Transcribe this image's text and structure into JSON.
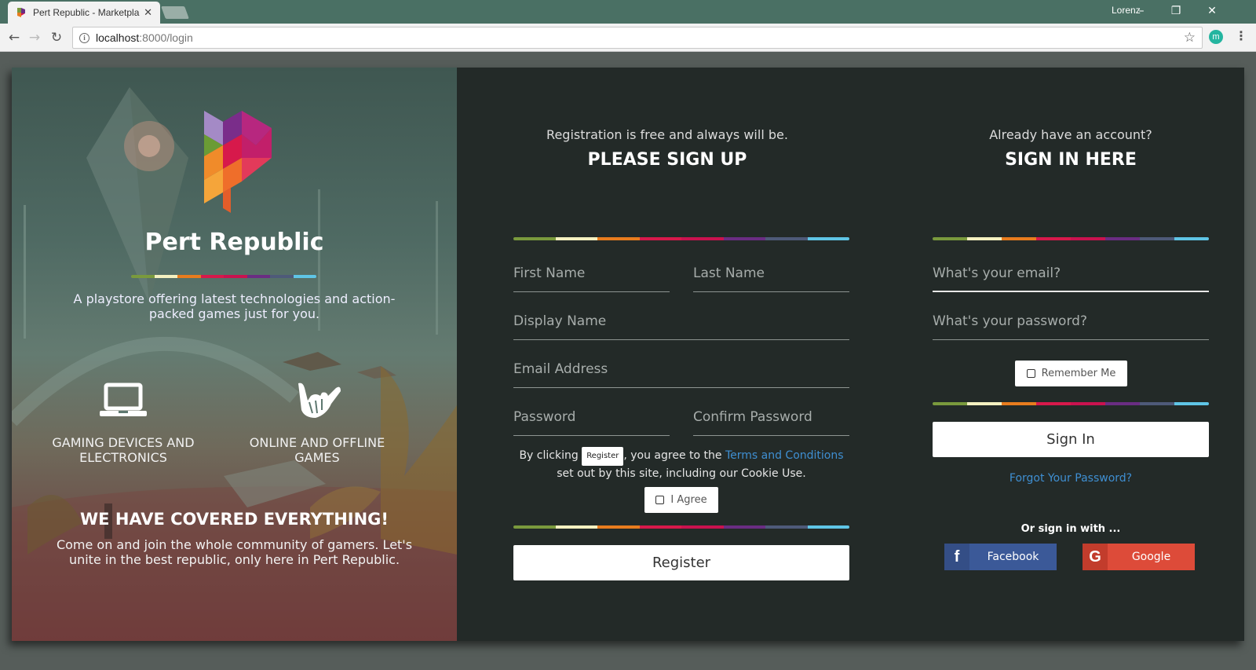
{
  "browser": {
    "tab_title": "Pert Republic - Marketpla",
    "url_host": "localhost",
    "url_rest": ":8000/login",
    "profile_name": "Lorenz",
    "extension_letter": "m"
  },
  "stripe_colors": [
    "#7a9a3d",
    "#f4f0c0",
    "#e87c1e",
    "#d7194b",
    "#c9124f",
    "#6a2d83",
    "#4e5a79",
    "#5fc5e6"
  ],
  "brand": {
    "name": "Pert Republic",
    "tagline": "A playstore offering latest technologies and action-packed games just for you."
  },
  "features": [
    {
      "label": "GAMING DEVICES AND ELECTRONICS",
      "icon": "laptop-icon"
    },
    {
      "label": "ONLINE AND OFFLINE GAMES",
      "icon": "shaka-hand-icon"
    }
  ],
  "cover": {
    "title": "WE HAVE COVERED EVERYTHING!",
    "text": "Come on and join the whole community of gamers. Let's unite in the best republic, only here in Pert Republic."
  },
  "signup": {
    "subtitle": "Registration is free and always will be.",
    "title": "PLEASE SIGN UP",
    "first_name_placeholder": "First Name",
    "last_name_placeholder": "Last Name",
    "display_name_placeholder": "Display Name",
    "email_placeholder": "Email Address",
    "password_placeholder": "Password",
    "confirm_password_placeholder": "Confirm Password",
    "agree_prefix": "By clicking",
    "agree_inline_button": "Register",
    "agree_middle": ", you agree to the",
    "terms_link": "Terms and Conditions",
    "agree_suffix": "set out by this site, including our Cookie Use.",
    "agree_checkbox": "I Agree",
    "register_button": "Register"
  },
  "signin": {
    "subtitle": "Already have an account?",
    "title": "SIGN IN HERE",
    "email_placeholder": "What's your email?",
    "password_placeholder": "What's your password?",
    "remember_checkbox": "Remember Me",
    "sign_in_button": "Sign In",
    "forgot_link": "Forgot Your Password?",
    "social_label": "Or sign in with ...",
    "facebook_button": "Facebook",
    "google_button": "Google",
    "facebook_color": "#3b5998",
    "google_color": "#dd4b39"
  }
}
